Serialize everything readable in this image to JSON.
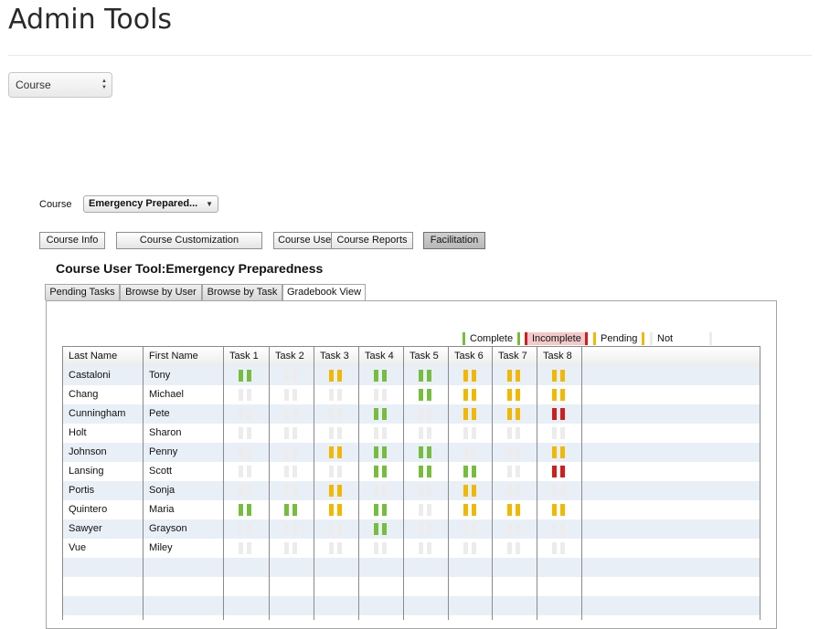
{
  "page": {
    "title": "Admin Tools"
  },
  "top_select": {
    "value": "Course"
  },
  "course_filter": {
    "label": "Course",
    "value": "Emergency Prepared..."
  },
  "toolbar": [
    {
      "label": "Course Info",
      "active": false
    },
    {
      "label": "Course Customization",
      "active": false
    },
    {
      "label": "Course User Tool",
      "active": false
    },
    {
      "label": "Course Reports",
      "active": false
    },
    {
      "label": "Facilitation",
      "active": true
    }
  ],
  "section": {
    "title": "Course User Tool:Emergency Preparedness"
  },
  "tabs": [
    {
      "label": "Pending Tasks",
      "active": false
    },
    {
      "label": "Browse by User",
      "active": false
    },
    {
      "label": "Browse by Task",
      "active": false
    },
    {
      "label": "Gradebook View",
      "active": true
    }
  ],
  "legend": [
    {
      "label": "Complete",
      "color": "#76bd3d"
    },
    {
      "label": "Incomplete",
      "color": "#cc1f1f",
      "background": "#f3c9c9"
    },
    {
      "label": "Pending",
      "color": "#f0b800"
    },
    {
      "label": "Not Started",
      "color": "#ececec"
    }
  ],
  "gradebook": {
    "columns": [
      "Last Name",
      "First Name",
      "Task 1",
      "Task 2",
      "Task 3",
      "Task 4",
      "Task 5",
      "Task 6",
      "Task 7",
      "Task 8"
    ],
    "rows": [
      {
        "last": "Castaloni",
        "first": "Tony",
        "tasks": [
          "complete",
          "not_started",
          "pending",
          "complete",
          "complete",
          "pending",
          "pending",
          "pending"
        ]
      },
      {
        "last": "Chang",
        "first": "Michael",
        "tasks": [
          "not_started",
          "not_started",
          "not_started",
          "not_started",
          "complete",
          "pending",
          "pending",
          "pending"
        ]
      },
      {
        "last": "Cunningham",
        "first": "Pete",
        "tasks": [
          "not_started",
          "not_started",
          "not_started",
          "complete",
          "not_started",
          "pending",
          "pending",
          "incomplete"
        ]
      },
      {
        "last": "Holt",
        "first": "Sharon",
        "tasks": [
          "not_started",
          "not_started",
          "not_started",
          "not_started",
          "not_started",
          "not_started",
          "not_started",
          "not_started"
        ]
      },
      {
        "last": "Johnson",
        "first": "Penny",
        "tasks": [
          "not_started",
          "not_started",
          "pending",
          "complete",
          "complete",
          "not_started",
          "not_started",
          "pending"
        ]
      },
      {
        "last": "Lansing",
        "first": "Scott",
        "tasks": [
          "not_started",
          "not_started",
          "not_started",
          "complete",
          "complete",
          "complete",
          "not_started",
          "incomplete"
        ]
      },
      {
        "last": "Portis",
        "first": "Sonja",
        "tasks": [
          "not_started",
          "not_started",
          "pending",
          "not_started",
          "not_started",
          "pending",
          "not_started",
          "not_started"
        ]
      },
      {
        "last": "Quintero",
        "first": "Maria",
        "tasks": [
          "complete",
          "complete",
          "pending",
          "complete",
          "not_started",
          "pending",
          "pending",
          "pending"
        ]
      },
      {
        "last": "Sawyer",
        "first": "Grayson",
        "tasks": [
          "not_started",
          "not_started",
          "not_started",
          "complete",
          "not_started",
          "not_started",
          "not_started",
          "not_started"
        ]
      },
      {
        "last": "Vue",
        "first": "Miley",
        "tasks": [
          "not_started",
          "not_started",
          "not_started",
          "not_started",
          "not_started",
          "not_started",
          "not_started",
          "not_started"
        ]
      }
    ],
    "empty_rows": 3
  }
}
